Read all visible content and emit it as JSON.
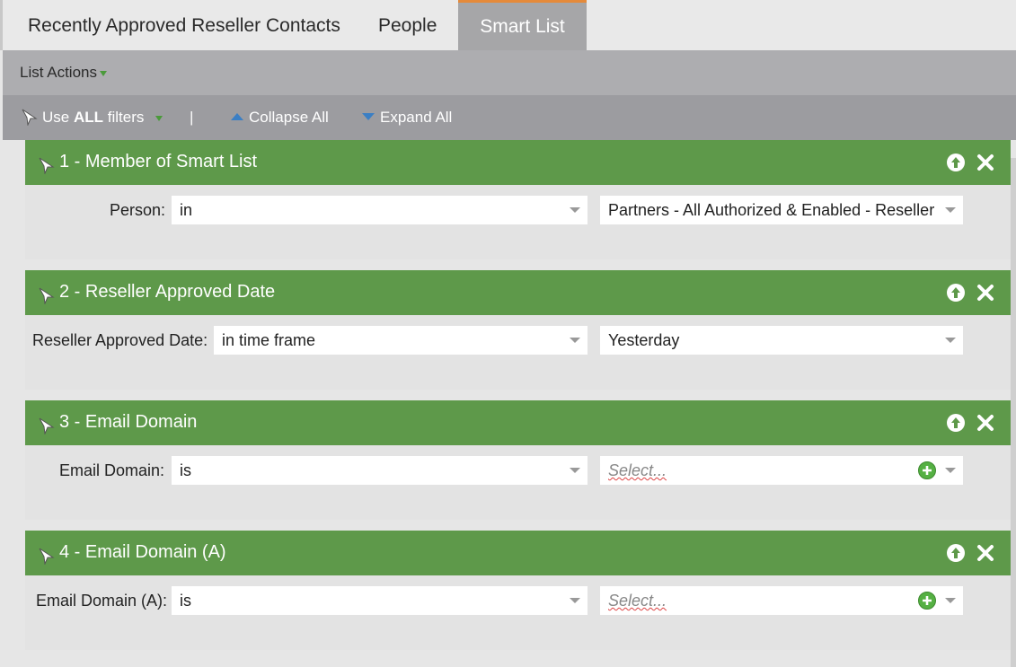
{
  "tabs": [
    {
      "label": "Recently Approved Reseller Contacts"
    },
    {
      "label": "People"
    },
    {
      "label": "Smart List"
    }
  ],
  "actions": {
    "list_actions_label": "List Actions"
  },
  "filter_toolbar": {
    "use_prefix": "Use ",
    "use_bold": "ALL",
    "use_suffix": " filters",
    "separator": "|",
    "collapse_label": "Collapse All",
    "expand_label": "Expand All"
  },
  "filters": [
    {
      "title": "1 - Member of Smart List",
      "field_label": "Person:",
      "operator": "in",
      "value": "Partners - All Authorized & Enabled - Reseller",
      "value_is_placeholder": false
    },
    {
      "title": "2 - Reseller Approved Date",
      "field_label": "Reseller Approved Date:",
      "operator": "in time frame",
      "value": "Yesterday",
      "value_is_placeholder": false
    },
    {
      "title": "3 - Email Domain",
      "field_label": "Email Domain:",
      "operator": "is",
      "value": "Select...",
      "value_is_placeholder": true
    },
    {
      "title": "4 - Email Domain (A)",
      "field_label": "Email Domain (A):",
      "operator": "is",
      "value": "Select...",
      "value_is_placeholder": true
    }
  ],
  "colors": {
    "header_green": "#5e994a",
    "active_tab": "#a6a6a8",
    "active_tab_accent": "#e58a3a",
    "toolbar": "#9c9ca0"
  }
}
